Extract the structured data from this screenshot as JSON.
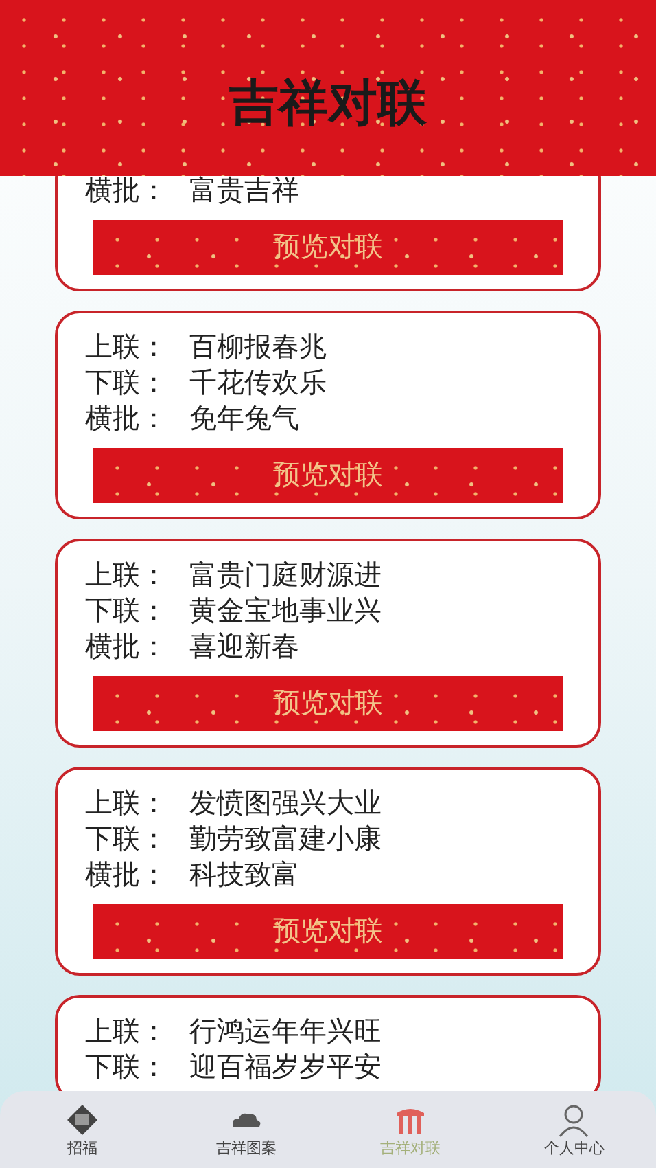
{
  "header": {
    "title": "吉祥对联"
  },
  "couplets": [
    {
      "lines": [
        {
          "label": "横批：",
          "text": "富贵吉祥"
        }
      ],
      "button": "预览对联"
    },
    {
      "lines": [
        {
          "label": "上联：",
          "text": "百柳报春兆"
        },
        {
          "label": "下联：",
          "text": "千花传欢乐"
        },
        {
          "label": "横批：",
          "text": "免年兔气"
        }
      ],
      "button": "预览对联"
    },
    {
      "lines": [
        {
          "label": "上联：",
          "text": "富贵门庭财源进"
        },
        {
          "label": "下联：",
          "text": "黄金宝地事业兴"
        },
        {
          "label": "横批：",
          "text": "喜迎新春"
        }
      ],
      "button": "预览对联"
    },
    {
      "lines": [
        {
          "label": "上联：",
          "text": "发愤图强兴大业"
        },
        {
          "label": "下联：",
          "text": "勤劳致富建小康"
        },
        {
          "label": "横批：",
          "text": "科技致富"
        }
      ],
      "button": "预览对联"
    },
    {
      "lines": [
        {
          "label": "上联：",
          "text": "行鸿运年年兴旺"
        },
        {
          "label": "下联：",
          "text": "迎百福岁岁平安"
        }
      ]
    }
  ],
  "tabs": [
    {
      "kind": "seal",
      "label": "招福",
      "selected": false
    },
    {
      "kind": "cloud",
      "label": "吉祥图案",
      "selected": false
    },
    {
      "kind": "gate",
      "label": "吉祥对联",
      "selected": true
    },
    {
      "kind": "person",
      "label": "个人中心",
      "selected": false
    }
  ]
}
